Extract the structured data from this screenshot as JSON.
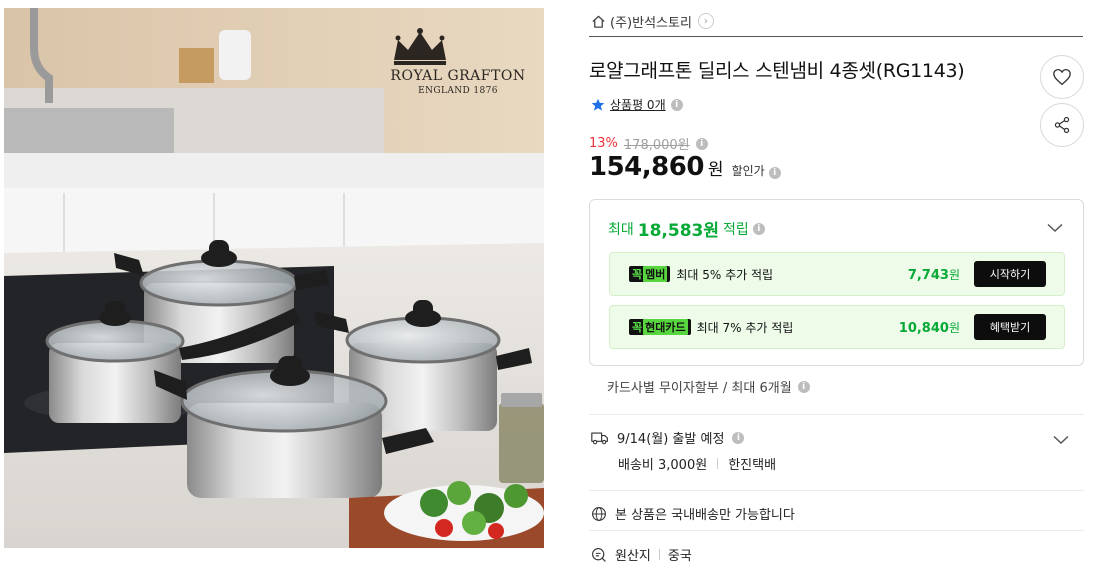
{
  "product_image": {
    "alt": "로얄그래프톤 딜리스 스텐냄비 4종셋",
    "logo_name": "ROYAL GRAFTON",
    "logo_sub": "ENGLAND 1876"
  },
  "store": {
    "home_icon": "home-icon",
    "name": "(주)반석스토리",
    "arrow": "›"
  },
  "product": {
    "title": "로얄그래프톤 딜리스 스텐냄비 4종셋(RG1143)"
  },
  "actions": {
    "like_icon": "heart-icon",
    "share_icon": "share-icon"
  },
  "rating": {
    "star_icon": "star-icon",
    "review_text": "상품평 0개",
    "star_color": "#1e6fe8"
  },
  "price": {
    "discount": "13%",
    "original": "178,000원",
    "sale": "154,860",
    "currency": "원",
    "sale_label": "할인가",
    "discount_color": "#f0313a"
  },
  "reward": {
    "prefix": "최대",
    "amount": "18,583원",
    "suffix": "적립",
    "accent": "#07a937",
    "benefits": [
      {
        "badge_k": "꼭",
        "badge_name": "멤버",
        "text": "최대 5% 추가 적립",
        "value": "7,743",
        "value_unit": "원",
        "action": "시작하기"
      },
      {
        "badge_k": "꼭",
        "badge_name": "현대카드",
        "text": "최대 7% 추가 적립",
        "value": "10,840",
        "value_unit": "원",
        "action": "혜택받기"
      }
    ]
  },
  "installment": {
    "text": "카드사별 무이자할부 / 최대 6개월"
  },
  "shipping": {
    "truck_icon": "truck-icon",
    "date": "9/14(월) 출발 예정",
    "fee": "배송비 3,000원",
    "carrier": "한진택배"
  },
  "domestic": {
    "globe_icon": "globe-icon",
    "text": "본 상품은 국내배송만 가능합니다"
  },
  "origin": {
    "label": "원산지",
    "value": "중국"
  }
}
